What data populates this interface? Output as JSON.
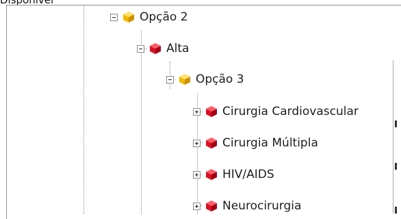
{
  "header": {
    "label": "Disponível"
  },
  "tree": {
    "nodes": [
      {
        "label": "Opção 2",
        "icon": "yellow-cube-icon",
        "toggle": "minus"
      },
      {
        "label": "Alta",
        "icon": "red-cube-icon",
        "toggle": "minus"
      },
      {
        "label": "Opção 3",
        "icon": "yellow-cube-icon",
        "toggle": "minus"
      },
      {
        "label": "Cirurgia Cardiovascular",
        "icon": "red-cube-icon",
        "toggle": "plus"
      },
      {
        "label": "Cirurgia Múltipla",
        "icon": "red-cube-icon",
        "toggle": "plus"
      },
      {
        "label": "HIV/AIDS",
        "icon": "red-cube-icon",
        "toggle": "plus"
      },
      {
        "label": "Neurocirurgia",
        "icon": "red-cube-icon",
        "toggle": "plus"
      }
    ]
  },
  "colors": {
    "yellow_cube": "#f2b900",
    "red_cube": "#d81224",
    "guide": "#8a8a8a"
  }
}
